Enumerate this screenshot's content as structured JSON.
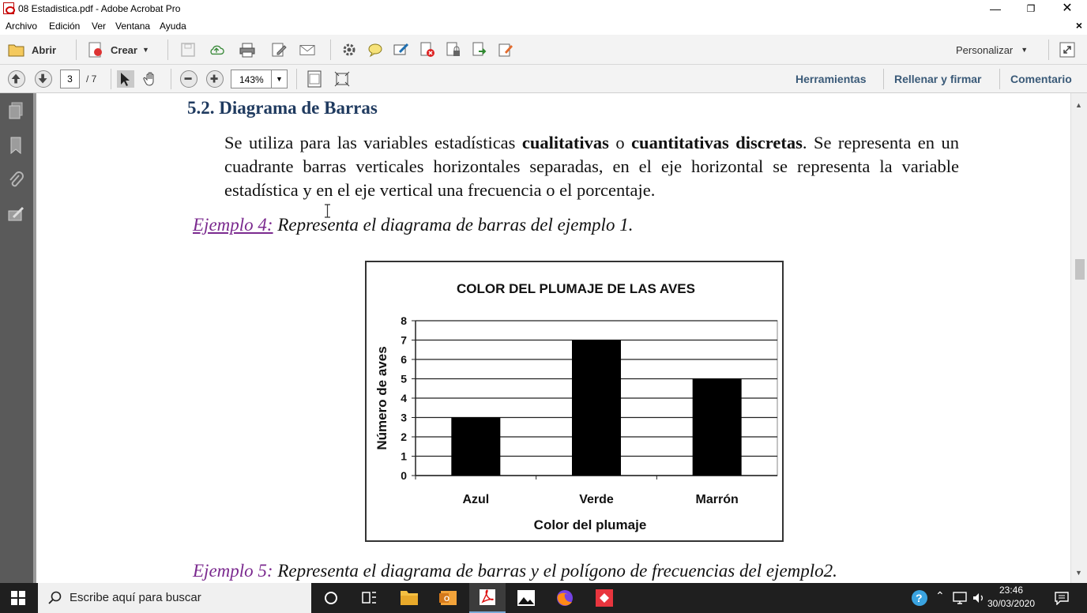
{
  "window": {
    "title": "08 Estadistica.pdf - Adobe Acrobat Pro"
  },
  "menu": {
    "items": [
      "Archivo",
      "Edición",
      "Ver",
      "Ventana",
      "Ayuda"
    ]
  },
  "toolbar": {
    "open_label": "Abrir",
    "create_label": "Crear",
    "customize_label": "Personalizar"
  },
  "nav": {
    "current_page": "3",
    "total_pages": "/ 7",
    "zoom": "143%"
  },
  "panels": {
    "tools": "Herramientas",
    "fill_sign": "Rellenar y firmar",
    "comment": "Comentario"
  },
  "document": {
    "section_title": "5.2. Diagrama de Barras",
    "para_part1": "Se utiliza para las variables estadísticas ",
    "para_bold1": "cualitativas",
    "para_part2": " o ",
    "para_bold2": "cuantitativas discretas",
    "para_part3": ". Se representa en un cuadrante barras verticales horizontales separadas, en el eje horizontal se representa la variable estadística y en el eje vertical una frecuencia o el porcentaje.",
    "example4_label": "Ejemplo 4:",
    "example4_text": " Representa el diagrama de barras del ejemplo 1.",
    "example5_label": "Ejemplo 5:",
    "example5_text": " Representa el diagrama de barras y el polígono de frecuencias del ejemplo2."
  },
  "chart_data": {
    "type": "bar",
    "title": "COLOR DEL PLUMAJE DE LAS AVES",
    "xlabel": "Color del plumaje",
    "ylabel": "Número de aves",
    "categories": [
      "Azul",
      "Verde",
      "Marrón"
    ],
    "values": [
      3,
      7,
      5
    ],
    "ylim": [
      0,
      8
    ],
    "yticks": [
      "0",
      "1",
      "2",
      "3",
      "4",
      "5",
      "6",
      "7",
      "8"
    ],
    "grid": true,
    "bar_color": "#000000"
  },
  "taskbar": {
    "search_placeholder": "Escribe aquí para buscar",
    "time": "23:46",
    "date": "30/03/2020"
  },
  "colors": {
    "section_title": "#1f3a5f",
    "link": "#7b2a8f",
    "panel_link": "#3a5a78"
  }
}
